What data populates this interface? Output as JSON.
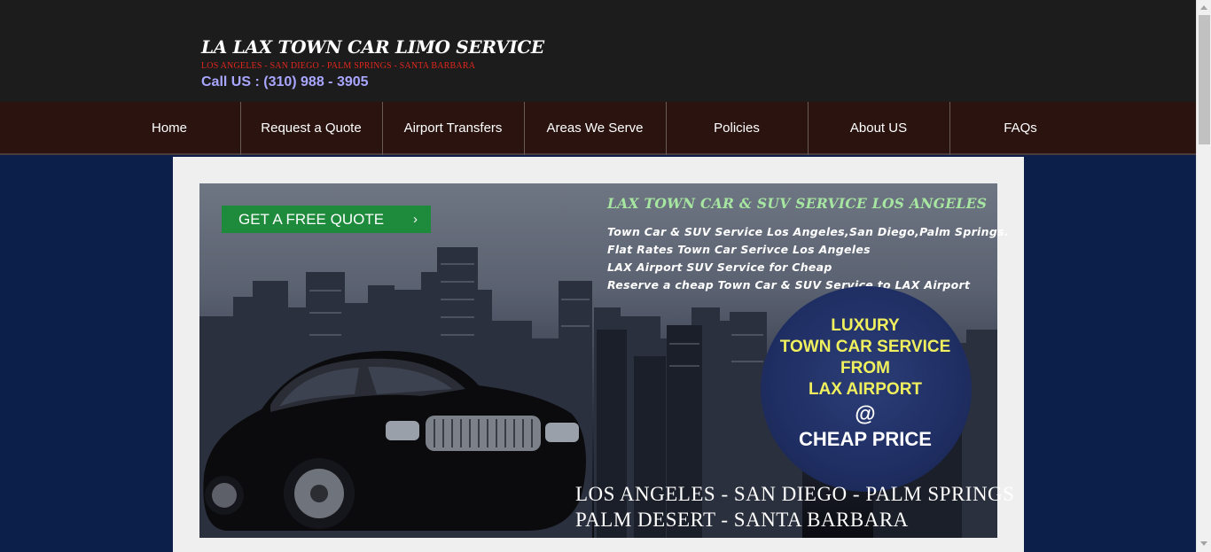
{
  "header": {
    "title": "LA LAX TOWN CAR LIMO SERVICE",
    "cities": "LOS ANGELES - SAN DIEGO - PALM SPRINGS - SANTA BARBARA",
    "call": "Call US : (310) 988 - 3905"
  },
  "nav": {
    "items": [
      {
        "label": "Home"
      },
      {
        "label": "Request a Quote"
      },
      {
        "label": "Airport Transfers"
      },
      {
        "label": "Areas We Serve"
      },
      {
        "label": "Policies"
      },
      {
        "label": "About US"
      },
      {
        "label": "FAQs"
      }
    ]
  },
  "hero": {
    "quote_button": "GET A FREE QUOTE",
    "quote_arrow": "›",
    "heading": "LAX TOWN CAR & SUV SERVICE LOS ANGELES",
    "lines": [
      "Town Car & SUV Service Los Angeles,San Diego,Palm Springs.",
      "Flat Rates Town Car Serivce Los Angeles",
      "LAX Airport SUV Service for Cheap",
      "Reserve a cheap Town Car & SUV Service to LAX Airport"
    ],
    "badge": {
      "line1": "LUXURY",
      "line2": "TOWN CAR SERVICE",
      "line3": "FROM",
      "line4": "LAX AIRPORT",
      "at": "@",
      "price": "CHEAP PRICE"
    },
    "bottom1": "LOS ANGELES - SAN DIEGO - PALM SPRINGS",
    "bottom2": "PALM DESERT - SANTA BARBARA"
  },
  "colors": {
    "header_bg": "#1c1c1c",
    "nav_bg": "#2b1410",
    "page_bg": "#0c1f4a",
    "title_red": "#e2261c",
    "call_color": "#a9a6ff",
    "button_green": "#1e8a3c",
    "heading_green": "#a6e6a0",
    "badge_yellow": "#f0f05e"
  }
}
